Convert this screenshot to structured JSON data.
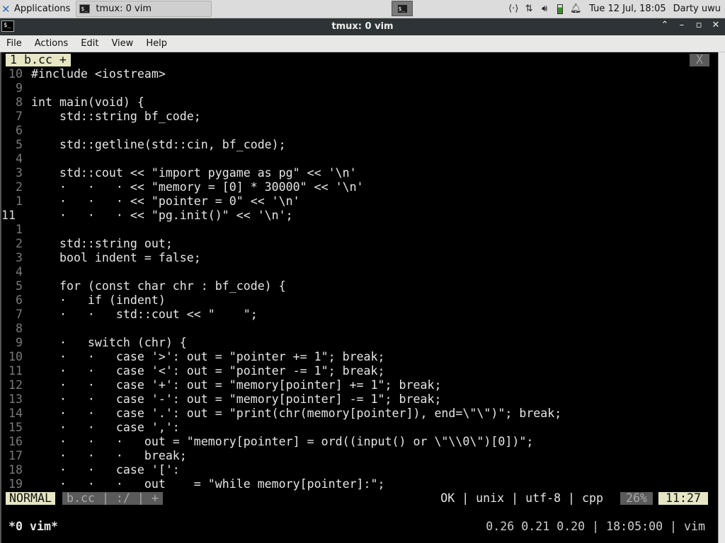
{
  "panel": {
    "applications_label": "Applications",
    "task_title": "tmux: 0 vim",
    "clock": "Tue 12 Jul, 18:05",
    "user": "Darty uwu"
  },
  "window": {
    "title": "tmux: 0 vim"
  },
  "menu": [
    "File",
    "Actions",
    "Edit",
    "View",
    "Help"
  ],
  "vim": {
    "tab_label": "1 b.cc +",
    "tab_close": "X",
    "lines": [
      {
        "n": "10",
        "t": "#include <iostream>"
      },
      {
        "n": "9",
        "t": ""
      },
      {
        "n": "8",
        "t": "int main(void) {"
      },
      {
        "n": "7",
        "t": "    std::string bf_code;"
      },
      {
        "n": "6",
        "t": ""
      },
      {
        "n": "5",
        "t": "    std::getline(std::cin, bf_code);"
      },
      {
        "n": "4",
        "t": ""
      },
      {
        "n": "3",
        "t": "    std::cout << \"import pygame as pg\" << '\\n'"
      },
      {
        "n": "2",
        "t": "    ·   ·   · << \"memory = [0] * 30000\" << '\\n'"
      },
      {
        "n": "1",
        "t": "    ·   ·   · << \"pointer = 0\" << '\\n'"
      },
      {
        "n": "11",
        "t": "    ·   ·   · << \"pg.init()\" << '\\n';",
        "current": true
      },
      {
        "n": "1",
        "t": ""
      },
      {
        "n": "2",
        "t": "    std::string out;"
      },
      {
        "n": "3",
        "t": "    bool indent = false;"
      },
      {
        "n": "4",
        "t": ""
      },
      {
        "n": "5",
        "t": "    for (const char chr : bf_code) {"
      },
      {
        "n": "6",
        "t": "    ·   if (indent)"
      },
      {
        "n": "7",
        "t": "    ·   ·   std::cout << \"    \";"
      },
      {
        "n": "8",
        "t": ""
      },
      {
        "n": "9",
        "t": "    ·   switch (chr) {"
      },
      {
        "n": "10",
        "t": "    ·   ·   case '>': out = \"pointer += 1\"; break;"
      },
      {
        "n": "11",
        "t": "    ·   ·   case '<': out = \"pointer -= 1\"; break;"
      },
      {
        "n": "12",
        "t": "    ·   ·   case '+': out = \"memory[pointer] += 1\"; break;"
      },
      {
        "n": "13",
        "t": "    ·   ·   case '-': out = \"memory[pointer] -= 1\"; break;"
      },
      {
        "n": "14",
        "t": "    ·   ·   case '.': out = \"print(chr(memory[pointer]), end=\\\"\\\")\"; break;"
      },
      {
        "n": "15",
        "t": "    ·   ·   case ',':"
      },
      {
        "n": "16",
        "t": "    ·   ·   ·   out = \"memory[pointer] = ord((input() or \\\"\\\\0\\\")[0])\";"
      },
      {
        "n": "17",
        "t": "    ·   ·   ·   break;"
      },
      {
        "n": "18",
        "t": "    ·   ·   case '[':"
      },
      {
        "n": "19",
        "t": "    ·   ·   ·   out    = \"while memory[pointer]:\";"
      }
    ],
    "status": {
      "mode": "NORMAL",
      "file_seg": "b.cc  | :/  | +",
      "right": "OK | unix | utf-8 | cpp",
      "percent": "26%",
      "position": "11:27"
    }
  },
  "tmux": {
    "left": "*0 vim*",
    "right": "0.26 0.21 0.20 | 18:05:00 | vim"
  }
}
